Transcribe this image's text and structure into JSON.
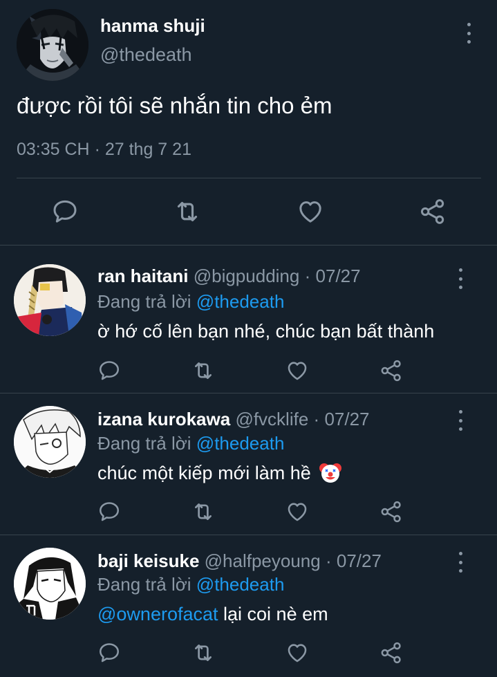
{
  "main_tweet": {
    "name": "hanma shuji",
    "handle": "@thedeath",
    "text": "được rồi tôi sẽ nhắn tin cho ẻm",
    "time": "03:35 CH",
    "sep": "·",
    "date": "27 thg 7 21",
    "actions": [
      "reply-icon",
      "retweet-icon",
      "like-icon",
      "share-icon"
    ]
  },
  "replies": [
    {
      "name": "ran haitani",
      "handle": "@bigpudding",
      "sep": "·",
      "date": "07/27",
      "replying_label": "Đang trả lời",
      "replying_to": "@thedeath",
      "text": "ờ hớ cố lên bạn nhé, chúc bạn bất thành"
    },
    {
      "name": "izana kurokawa",
      "handle": "@fvcklife",
      "sep": "·",
      "date": "07/27",
      "replying_label": "Đang trả lời",
      "replying_to": "@thedeath",
      "text": "chúc một kiếp mới làm hề",
      "emoji": "clown-face-icon"
    },
    {
      "name": "baji keisuke",
      "handle": "@halfpeyoung",
      "sep": "·",
      "date": "07/27",
      "replying_label": "Đang trả lời",
      "replying_to": "@thedeath",
      "mention": "@ownerofacat",
      "text": "lại coi nè em"
    }
  ],
  "colors": {
    "background": "#15202b",
    "text": "#ffffff",
    "muted": "#8b98a5",
    "link": "#1d9bf0",
    "divider": "#38444d"
  }
}
